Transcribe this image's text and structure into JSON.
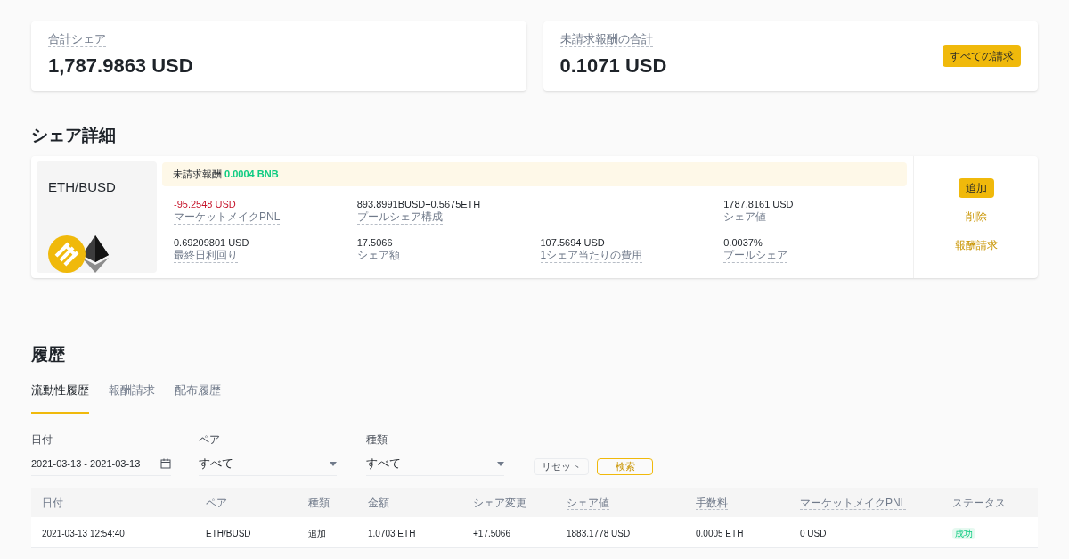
{
  "summary_cards": [
    {
      "label": "合計シェア",
      "value": "1,787.9863 USD"
    },
    {
      "label": "未請求報酬の合計",
      "value": "0.1071 USD",
      "button": "すべての請求"
    }
  ],
  "share_details": {
    "title": "シェア詳細",
    "pair": "ETH/BUSD",
    "reward_label": "未請求報酬",
    "reward_value": "0.0004 BNB",
    "stat_rows": [
      [
        {
          "value": "-95.2548 USD",
          "label": "マーケットメイクPNL",
          "negative": true,
          "dashed": true
        },
        {
          "value": "893.8991BUSD+0.5675ETH",
          "label": "プールシェア構成",
          "negative": false,
          "dashed": true
        },
        {
          "value": "1787.8161 USD",
          "label": "シェア値",
          "negative": false,
          "dashed": false
        }
      ],
      [
        {
          "value": "0.69209801 USD",
          "label": "最終日利回り",
          "negative": false,
          "dashed": true
        },
        {
          "value": "17.5066",
          "label": "シェア額",
          "negative": false,
          "dashed": false
        },
        {
          "value": "107.5694 USD",
          "label": "1シェア当たりの費用",
          "negative": false,
          "dashed": true
        },
        {
          "value": "0.0037%",
          "label": "プールシェア",
          "negative": false,
          "dashed": true
        }
      ]
    ],
    "actions": [
      {
        "label": "追加",
        "kind": "primary"
      },
      {
        "label": "削除",
        "kind": "link"
      },
      {
        "label": "報酬請求",
        "kind": "link"
      }
    ]
  },
  "history": {
    "title": "履歴",
    "tabs": [
      {
        "label": "流動性履歴",
        "selected": true
      },
      {
        "label": "報酬請求",
        "selected": false
      },
      {
        "label": "配布履歴",
        "selected": false
      }
    ],
    "filters": [
      {
        "label": "日付",
        "value": "2021-03-13 - 2021-03-13",
        "kind": "date"
      },
      {
        "label": "ペア",
        "value": "すべて",
        "kind": "select"
      },
      {
        "label": "種類",
        "value": "すべて",
        "kind": "select"
      }
    ],
    "buttons": [
      {
        "label": "リセット",
        "kind": "secondary"
      },
      {
        "label": "検索",
        "kind": "primary"
      }
    ],
    "table": {
      "columns": [
        {
          "label": "日付",
          "dashed": false
        },
        {
          "label": "ペア",
          "dashed": false
        },
        {
          "label": "種類",
          "dashed": false
        },
        {
          "label": "金額",
          "dashed": false
        },
        {
          "label": "シェア変更",
          "dashed": false
        },
        {
          "label": "シェア値",
          "dashed": true
        },
        {
          "label": "手数料",
          "dashed": true
        },
        {
          "label": "マーケットメイクPNL",
          "dashed": true
        },
        {
          "label": "ステータス",
          "dashed": false
        }
      ],
      "rows": [
        {
          "cells": [
            "2021-03-13 12:54:40",
            "ETH/BUSD",
            "追加",
            "1.0703 ETH",
            "+17.5066",
            "1883.1778 USD",
            "0.0005 ETH",
            "0 USD"
          ],
          "status": "成功"
        }
      ]
    }
  }
}
